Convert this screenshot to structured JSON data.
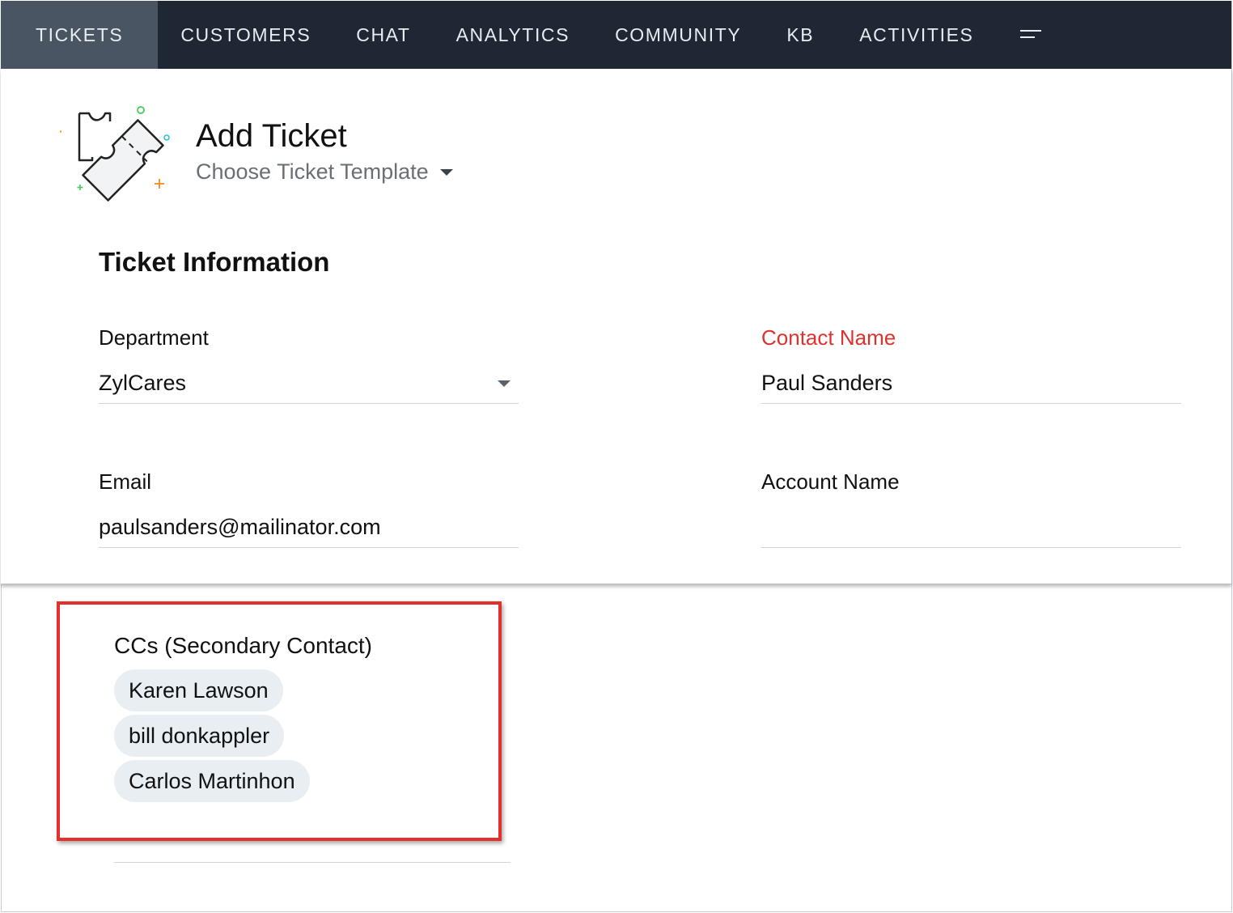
{
  "nav": {
    "tabs": [
      {
        "label": "TICKETS",
        "active": true
      },
      {
        "label": "CUSTOMERS"
      },
      {
        "label": "CHAT"
      },
      {
        "label": "ANALYTICS"
      },
      {
        "label": "COMMUNITY"
      },
      {
        "label": "KB"
      },
      {
        "label": "ACTIVITIES"
      }
    ],
    "more_icon": "menu-lines-icon",
    "bg_color": "#1f2734",
    "active_bg_color": "#4a5563"
  },
  "header": {
    "title": "Add Ticket",
    "template_label": "Choose Ticket Template",
    "icon": "ticket-icon"
  },
  "section": {
    "title": "Ticket Information"
  },
  "fields": {
    "department": {
      "label": "Department",
      "value": "ZylCares"
    },
    "contact_name": {
      "label": "Contact Name",
      "value": "Paul Sanders",
      "required_color": "#e0312d"
    },
    "email": {
      "label": "Email",
      "value": "paulsanders@mailinator.com"
    },
    "account_name": {
      "label": "Account Name",
      "value": ""
    }
  },
  "cc": {
    "label": "CCs (Secondary Contact)",
    "contacts": [
      "Karen Lawson",
      "bill donkappler",
      "Carlos Martinhon"
    ],
    "highlight_color": "#e3302b"
  }
}
